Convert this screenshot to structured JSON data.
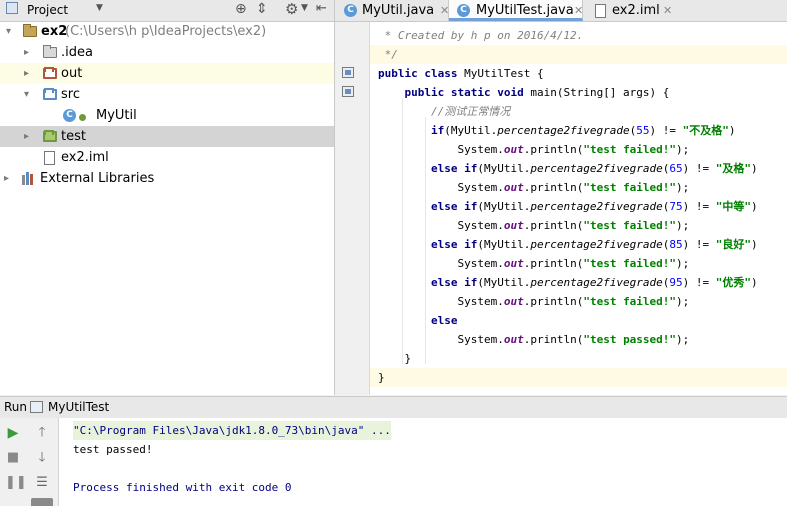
{
  "project_panel": {
    "title": "Project",
    "tree": [
      {
        "label": "ex2",
        "path": "(C:\\Users\\h p\\IdeaProjects\\ex2)",
        "arrow": "▾"
      },
      {
        "label": ".idea",
        "arrow": "▸"
      },
      {
        "label": "out",
        "arrow": "▸"
      },
      {
        "label": "src",
        "arrow": "▾"
      },
      {
        "label": "MyUtil",
        "badge": "C"
      },
      {
        "label": "test",
        "arrow": "▸"
      },
      {
        "label": "ex2.iml"
      },
      {
        "label": "External Libraries",
        "arrow": "▸"
      }
    ]
  },
  "tabs": [
    {
      "label": "MyUtil.java",
      "badge": "C"
    },
    {
      "label": "MyUtilTest.java",
      "badge": "C"
    },
    {
      "label": "ex2.iml"
    }
  ],
  "editor": {
    "lines": [
      [
        {
          "t": " * Created by h p on 2016/4/12.",
          "c": "cm"
        }
      ],
      [
        {
          "t": " */",
          "c": "cm"
        }
      ],
      [
        {
          "t": "public class",
          "c": "kw"
        },
        {
          "t": " MyUtilTest {"
        }
      ],
      [
        {
          "t": "    "
        },
        {
          "t": "public static void",
          "c": "kw"
        },
        {
          "t": " main(String[] args) {"
        }
      ],
      [
        {
          "t": "        //测试正常情况",
          "c": "cm"
        }
      ],
      [
        {
          "t": "        "
        },
        {
          "t": "if",
          "c": "kw"
        },
        {
          "t": "(MyUtil."
        },
        {
          "t": "percentage2fivegrade",
          "c": "mth"
        },
        {
          "t": "("
        },
        {
          "t": "55",
          "c": "num"
        },
        {
          "t": ") != "
        },
        {
          "t": "\"不及格\"",
          "c": "st"
        },
        {
          "t": ")"
        }
      ],
      [
        {
          "t": "            System."
        },
        {
          "t": "out",
          "c": "fld"
        },
        {
          "t": ".println("
        },
        {
          "t": "\"test failed!\"",
          "c": "st"
        },
        {
          "t": ");"
        }
      ],
      [
        {
          "t": "        "
        },
        {
          "t": "else if",
          "c": "kw"
        },
        {
          "t": "(MyUtil."
        },
        {
          "t": "percentage2fivegrade",
          "c": "mth"
        },
        {
          "t": "("
        },
        {
          "t": "65",
          "c": "num"
        },
        {
          "t": ") != "
        },
        {
          "t": "\"及格\"",
          "c": "st"
        },
        {
          "t": ")"
        }
      ],
      [
        {
          "t": "            System."
        },
        {
          "t": "out",
          "c": "fld"
        },
        {
          "t": ".println("
        },
        {
          "t": "\"test failed!\"",
          "c": "st"
        },
        {
          "t": ");"
        }
      ],
      [
        {
          "t": "        "
        },
        {
          "t": "else if",
          "c": "kw"
        },
        {
          "t": "(MyUtil."
        },
        {
          "t": "percentage2fivegrade",
          "c": "mth"
        },
        {
          "t": "("
        },
        {
          "t": "75",
          "c": "num"
        },
        {
          "t": ") != "
        },
        {
          "t": "\"中等\"",
          "c": "st"
        },
        {
          "t": ")"
        }
      ],
      [
        {
          "t": "            System."
        },
        {
          "t": "out",
          "c": "fld"
        },
        {
          "t": ".println("
        },
        {
          "t": "\"test failed!\"",
          "c": "st"
        },
        {
          "t": ");"
        }
      ],
      [
        {
          "t": "        "
        },
        {
          "t": "else if",
          "c": "kw"
        },
        {
          "t": "(MyUtil."
        },
        {
          "t": "percentage2fivegrade",
          "c": "mth"
        },
        {
          "t": "("
        },
        {
          "t": "85",
          "c": "num"
        },
        {
          "t": ") != "
        },
        {
          "t": "\"良好\"",
          "c": "st"
        },
        {
          "t": ")"
        }
      ],
      [
        {
          "t": "            System."
        },
        {
          "t": "out",
          "c": "fld"
        },
        {
          "t": ".println("
        },
        {
          "t": "\"test failed!\"",
          "c": "st"
        },
        {
          "t": ");"
        }
      ],
      [
        {
          "t": "        "
        },
        {
          "t": "else if",
          "c": "kw"
        },
        {
          "t": "(MyUtil."
        },
        {
          "t": "percentage2fivegrade",
          "c": "mth"
        },
        {
          "t": "("
        },
        {
          "t": "95",
          "c": "num"
        },
        {
          "t": ") != "
        },
        {
          "t": "\"优秀\"",
          "c": "st"
        },
        {
          "t": ")"
        }
      ],
      [
        {
          "t": "            System."
        },
        {
          "t": "out",
          "c": "fld"
        },
        {
          "t": ".println("
        },
        {
          "t": "\"test failed!\"",
          "c": "st"
        },
        {
          "t": ");"
        }
      ],
      [
        {
          "t": "        "
        },
        {
          "t": "else",
          "c": "kw"
        }
      ],
      [
        {
          "t": "            System."
        },
        {
          "t": "out",
          "c": "fld"
        },
        {
          "t": ".println("
        },
        {
          "t": "\"test passed!\"",
          "c": "st"
        },
        {
          "t": ");"
        }
      ],
      [
        {
          "t": "    }"
        }
      ],
      [
        {
          "t": "}"
        }
      ]
    ]
  },
  "run_panel": {
    "label": "Run",
    "config": "MyUtilTest",
    "console": {
      "command": "\"C:\\Program Files\\Java\\jdk1.8.0_73\\bin\\java\" ...",
      "output": "test passed!",
      "exit": "Process finished with exit code 0"
    }
  },
  "colors": {
    "accent": "#73a0d6",
    "keyword": "#000080",
    "string": "#008000",
    "number": "#0000ff"
  }
}
